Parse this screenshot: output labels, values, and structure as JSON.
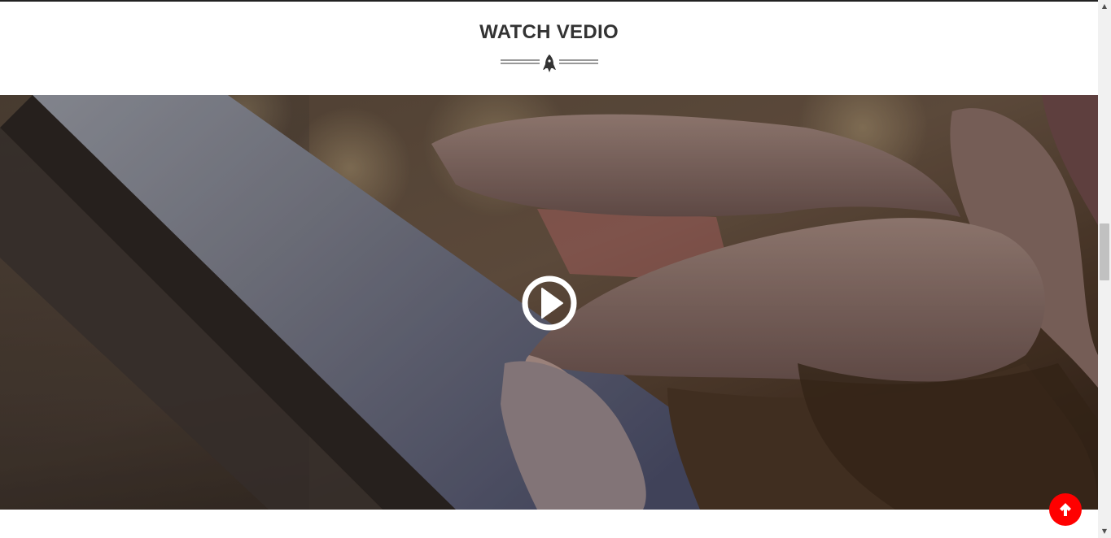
{
  "section": {
    "title": "WATCH VEDIO",
    "divider_icon": "rocket-icon"
  },
  "video": {
    "play_icon": "play-circle-icon",
    "background": "finger-touching-tablet-photo"
  },
  "back_to_top": {
    "icon": "arrow-up-icon",
    "color": "#ff0000"
  },
  "scrollbar": {
    "up_arrow": "▲",
    "down_arrow": "▼"
  },
  "colors": {
    "title": "#333333",
    "accent": "#ff0000"
  }
}
